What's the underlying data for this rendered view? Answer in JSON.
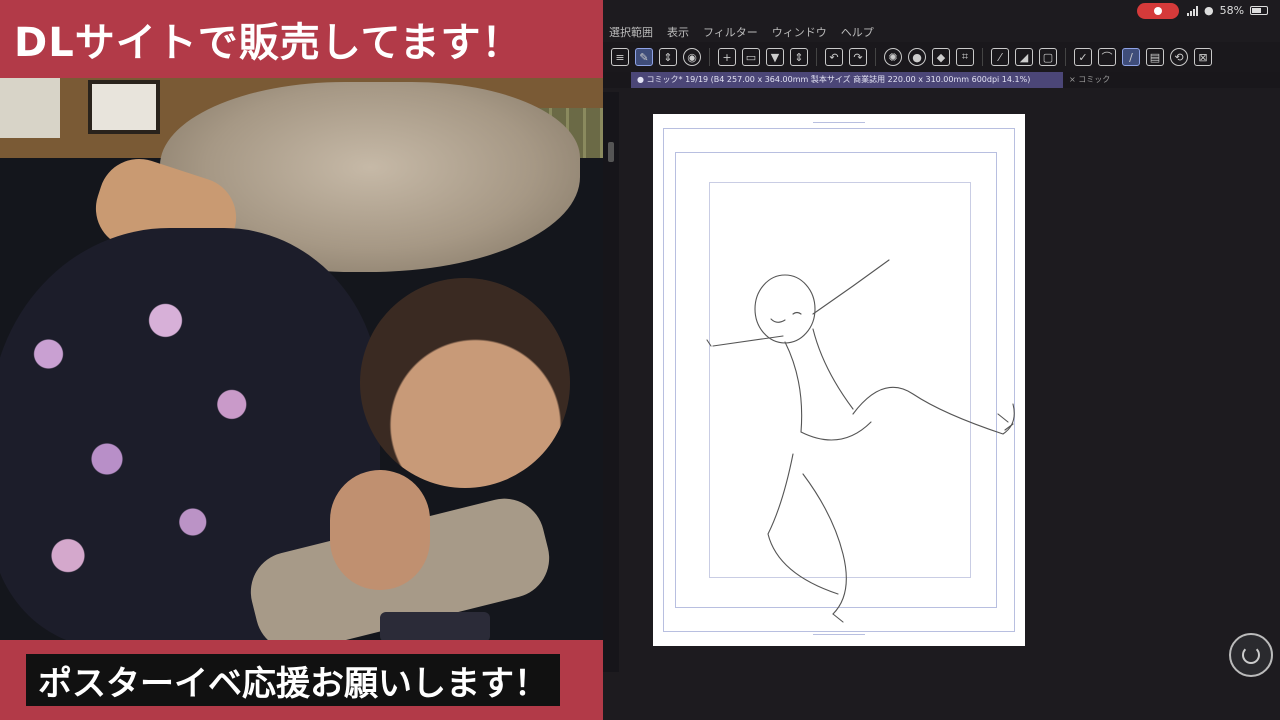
{
  "banners": {
    "top": "DLサイトで販売してます！",
    "bottom": "ポスターイベ応援お願いします！"
  },
  "status": {
    "battery": "58%"
  },
  "menu": {
    "items": [
      "選択範囲",
      "表示",
      "フィルター",
      "ウィンドウ",
      "ヘルプ"
    ]
  },
  "document": {
    "tab_label": "● コミック* 19/19 (B4 257.00 x 364.00mm 製本サイズ 商業誌用 220.00 x 310.00mm 600dpi 14.1%)",
    "tab2_label": "× コミック"
  },
  "colors": {
    "banner": "#b23a48",
    "app_bg": "#1d1b1f",
    "active_tool": "#3f4d7a"
  },
  "icons": {
    "toolbar": [
      "menu-icon",
      "pen-tool-icon",
      "up-down-icon",
      "camera-icon",
      "new-file-icon",
      "open-folder-icon",
      "save-icon",
      "up-down-icon",
      "undo-icon",
      "redo-icon",
      "settings-icon",
      "circle-icon",
      "bucket-icon",
      "transform-icon",
      "deselect-icon",
      "shape-icon",
      "fill-icon",
      "pen-check-icon",
      "brush-icon",
      "active-brush-icon",
      "layer-icon",
      "swap-icon",
      "close-box-icon"
    ],
    "floating": "rotate-icon"
  }
}
